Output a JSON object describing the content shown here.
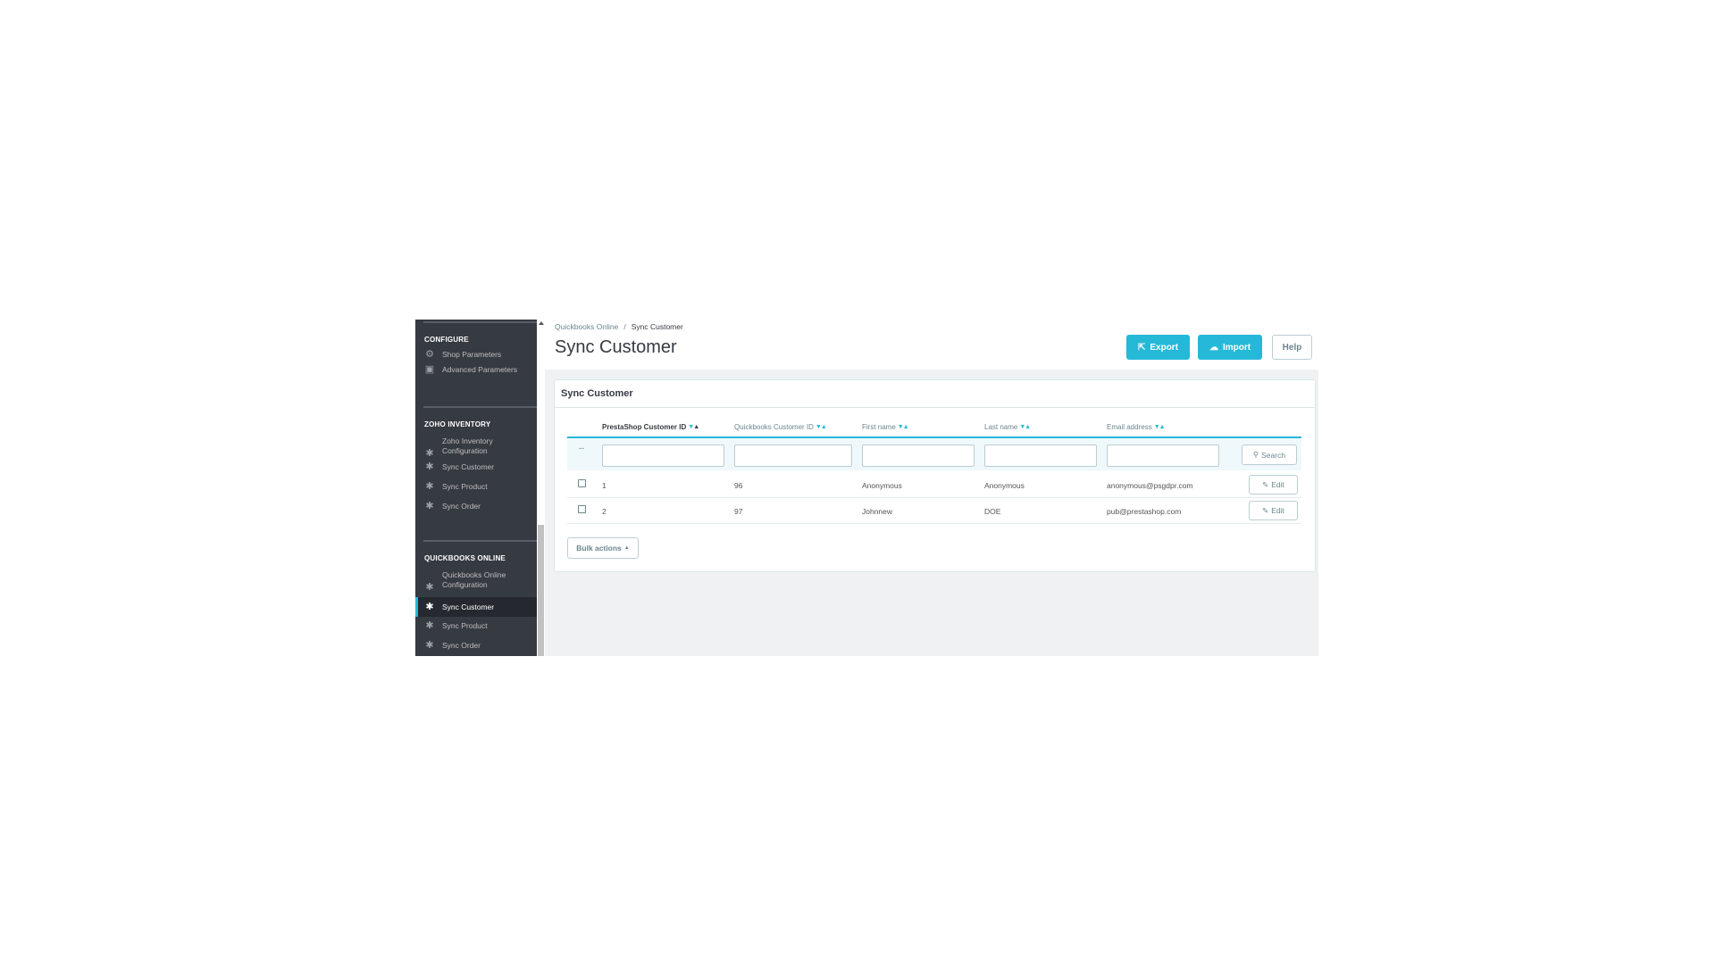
{
  "sidebar": {
    "sections": [
      {
        "heading": "CONFIGURE",
        "items": [
          {
            "label_lines": [
              "Shop Parameters"
            ],
            "icon": "gear-icon",
            "active": false
          },
          {
            "label_lines": [
              "Advanced Parameters"
            ],
            "icon": "settings-box-icon",
            "active": false
          }
        ]
      },
      {
        "heading": "ZOHO INVENTORY",
        "items": [
          {
            "label_lines": [
              "Zoho Inventory",
              "Configuration"
            ],
            "icon": "puzzle-icon",
            "active": false
          },
          {
            "label_lines": [
              "Sync Customer"
            ],
            "icon": "puzzle-icon",
            "active": false
          },
          {
            "label_lines": [
              "Sync Product"
            ],
            "icon": "puzzle-icon",
            "active": false
          },
          {
            "label_lines": [
              "Sync Order"
            ],
            "icon": "puzzle-icon",
            "active": false
          }
        ]
      },
      {
        "heading": "QUICKBOOKS ONLINE",
        "items": [
          {
            "label_lines": [
              "Quickbooks Online",
              "Configuration"
            ],
            "icon": "puzzle-icon",
            "active": false
          },
          {
            "label_lines": [
              "Sync Customer"
            ],
            "icon": "puzzle-icon",
            "active": true
          },
          {
            "label_lines": [
              "Sync Product"
            ],
            "icon": "puzzle-icon",
            "active": false
          },
          {
            "label_lines": [
              "Sync Order"
            ],
            "icon": "puzzle-icon",
            "active": false
          }
        ]
      }
    ]
  },
  "header": {
    "breadcrumb": {
      "parent": "Quickbooks Online",
      "separator": "/",
      "current": "Sync Customer"
    },
    "title": "Sync Customer",
    "buttons": {
      "export": "Export",
      "import": "Import",
      "help": "Help"
    }
  },
  "panel": {
    "title": "Sync Customer",
    "columns": [
      {
        "label": "PrestaShop Customer ID",
        "sorted": true
      },
      {
        "label": "Quickbooks Customer ID",
        "sorted": false
      },
      {
        "label": "First name",
        "sorted": false
      },
      {
        "label": "Last name",
        "sorted": false
      },
      {
        "label": "Email address",
        "sorted": false
      }
    ],
    "filter_dash": "--",
    "search_label": "Search",
    "rows": [
      {
        "prestashop_id": "1",
        "quickbooks_id": "96",
        "first_name": "Anonymous",
        "last_name": "Anonymous",
        "email": "anonymous@psgdpr.com",
        "action": "Edit"
      },
      {
        "prestashop_id": "2",
        "quickbooks_id": "97",
        "first_name": "Johnnew",
        "last_name": "DOE",
        "email": "pub@prestashop.com",
        "action": "Edit"
      }
    ],
    "bulk_actions": "Bulk actions"
  },
  "colors": {
    "accent": "#25b9d7",
    "sidebar_bg": "#363a41",
    "page_bg": "#eff1f2"
  }
}
